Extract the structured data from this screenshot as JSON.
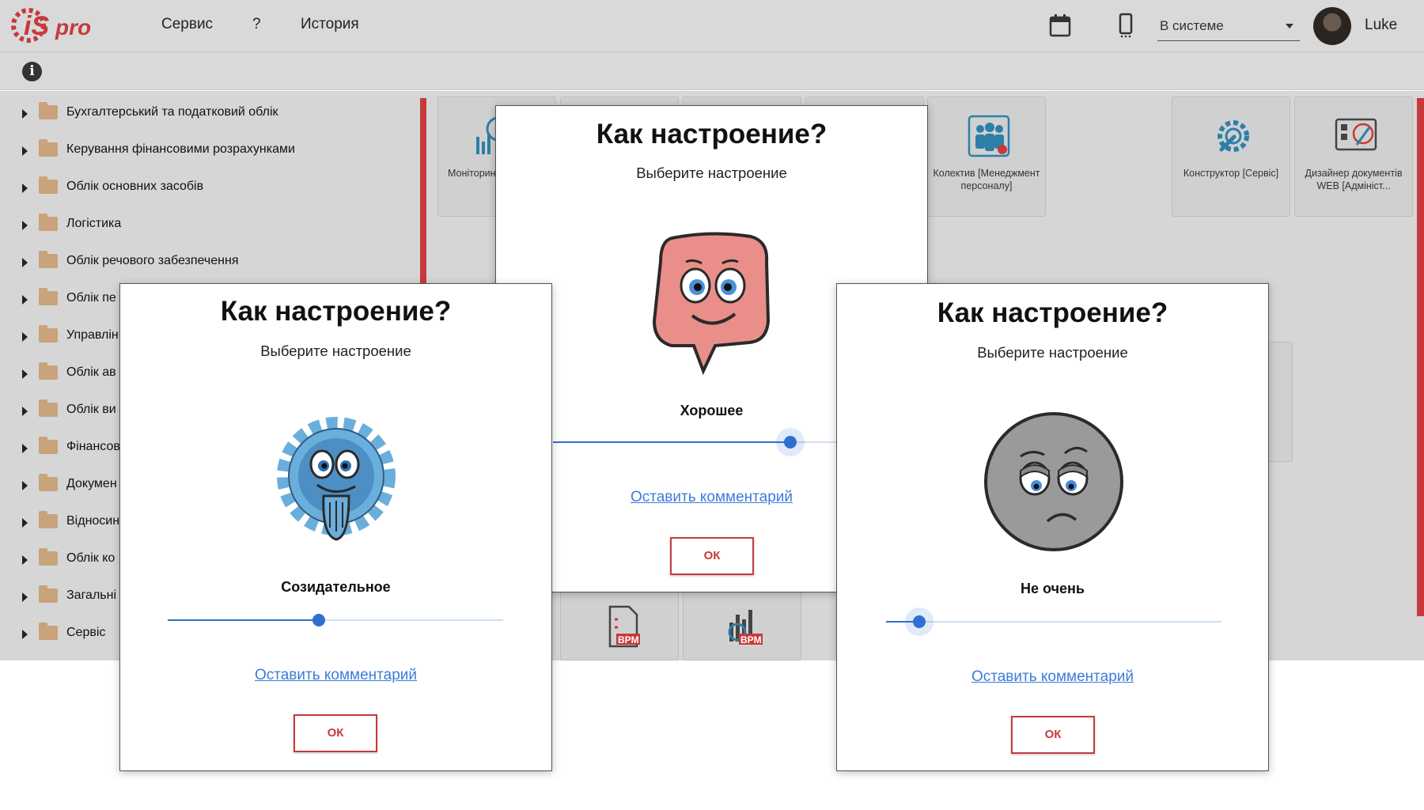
{
  "header": {
    "menu": [
      "Сервис",
      "?",
      "История"
    ],
    "status": "В системе",
    "username": "Luke"
  },
  "tree": [
    "Бухгалтерський та податковий облік",
    "Керування фінансовими розрахунками",
    "Облік основних засобів",
    "Логістика",
    "Облік речового забезпечення",
    "Облік пе",
    "Управлін",
    "Облік ав",
    "Облік ви",
    "Фінансов",
    "Докумен",
    "Відносин",
    "Облік ко",
    "Загальні",
    "Сервіс"
  ],
  "tiles": [
    {
      "label": "Моніторин [Стати"
    },
    {
      "label": "Колектив [Менеджмент персоналу]"
    },
    {
      "label": "Конструктор [Сервіс]"
    },
    {
      "label": "Дизайнер документів WEB [Адмініст..."
    }
  ],
  "dialog_center": {
    "title": "Как настроение?",
    "subtitle": "Выберите настроение",
    "mood": "Хорошее",
    "slider_value": 0.75,
    "link": "Оставить комментарий",
    "ok": "ОК"
  },
  "dialog_left": {
    "title": "Как настроение?",
    "subtitle": "Выберите настроение",
    "mood": "Созидательное",
    "slider_value": 0.45,
    "link": "Оставить комментарий",
    "ok": "ОК"
  },
  "dialog_right": {
    "title": "Как настроение?",
    "subtitle": "Выберите настроение",
    "mood": "Не очень",
    "slider_value": 0.1,
    "link": "Оставить комментарий",
    "ok": "ОК"
  },
  "colors": {
    "accent_red": "#c63a3c",
    "slider_blue": "#2f6fd0",
    "link_blue": "#3d7cd8",
    "folder": "#c9a37b"
  }
}
